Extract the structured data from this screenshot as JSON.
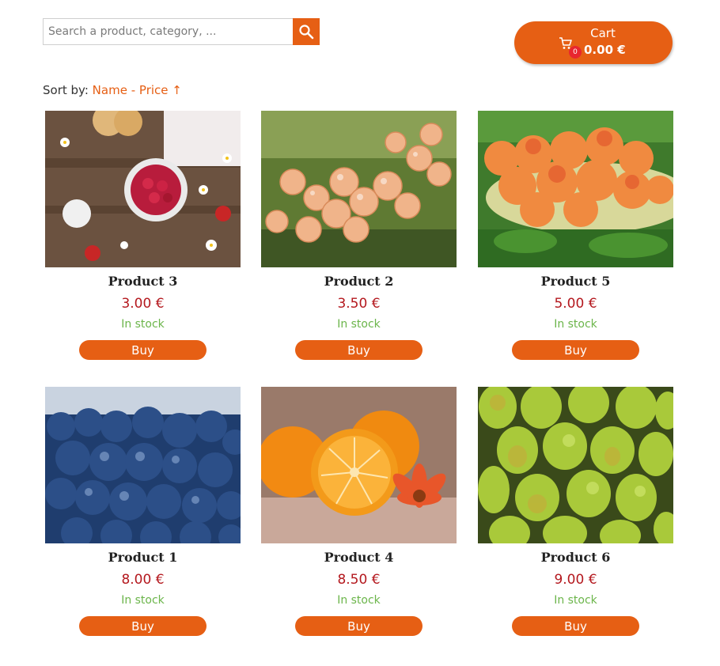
{
  "search": {
    "placeholder": "Search a product, category, ...",
    "button_icon": "search-icon"
  },
  "cart": {
    "title": "Cart",
    "count": "0",
    "total": "0.00 €",
    "icon": "cart-icon"
  },
  "sort": {
    "label": "Sort by:",
    "name_option": "Name",
    "separator": "-",
    "price_option": "Price ↑"
  },
  "colors": {
    "accent": "#e65f14",
    "price": "#b4181e",
    "stock": "#6bb54a",
    "badge": "#e8262f"
  },
  "products": [
    {
      "name": "Product 3",
      "price": "3.00 €",
      "stock": "In stock",
      "buy": "Buy",
      "image": "raspberries-photo"
    },
    {
      "name": "Product 2",
      "price": "3.50 €",
      "stock": "In stock",
      "buy": "Buy",
      "image": "currants-photo"
    },
    {
      "name": "Product 5",
      "price": "5.00 €",
      "stock": "In stock",
      "buy": "Buy",
      "image": "apricots-photo"
    },
    {
      "name": "Product 1",
      "price": "8.00 €",
      "stock": "In stock",
      "buy": "Buy",
      "image": "blueberries-photo"
    },
    {
      "name": "Product 4",
      "price": "8.50 €",
      "stock": "In stock",
      "buy": "Buy",
      "image": "oranges-photo"
    },
    {
      "name": "Product 6",
      "price": "9.00 €",
      "stock": "In stock",
      "buy": "Buy",
      "image": "pears-photo"
    }
  ]
}
